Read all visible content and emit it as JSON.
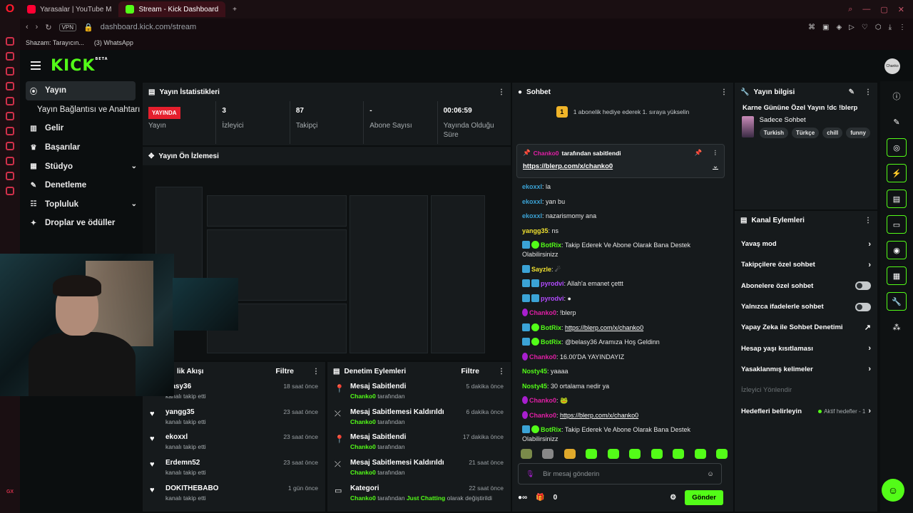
{
  "browser": {
    "tabs": [
      {
        "label": "Yarasalar | YouTube M",
        "active": false
      },
      {
        "label": "Stream - Kick Dashboard",
        "active": true
      }
    ],
    "new_tab": "+",
    "vpn": "VPN",
    "url": "dashboard.kick.com/stream",
    "bookmarks": [
      "Shazam: Tarayıcın...",
      "(3) WhatsApp"
    ],
    "gx": "GX"
  },
  "app": {
    "logo": "KICK",
    "logo_badge": "BETA",
    "avatar_text": "Chanko"
  },
  "nav": {
    "items": [
      {
        "label": "Yayın",
        "icon": "((•))"
      },
      {
        "label": "Yayın Bağlantısı ve Anahtarı",
        "icon": ""
      },
      {
        "label": "Gelir",
        "icon": "▣"
      },
      {
        "label": "Başarılar",
        "icon": "🏆"
      },
      {
        "label": "Stüdyo",
        "icon": "▦",
        "chevron": "⌄"
      },
      {
        "label": "Denetleme",
        "icon": "🔧"
      },
      {
        "label": "Topluluk",
        "icon": "👥",
        "chevron": "⌄"
      },
      {
        "label": "Droplar ve ödüller",
        "icon": "🎁"
      }
    ]
  },
  "stats": {
    "title": "Yayın İstatistikleri",
    "badge": "YAYINDA",
    "cells": [
      {
        "value": "",
        "label": "Yayın"
      },
      {
        "value": "3",
        "label": "İzleyici"
      },
      {
        "value": "87",
        "label": "Takipçi"
      },
      {
        "value": "-",
        "label": "Abone Sayısı"
      },
      {
        "value": "00:06:59",
        "label": "Yayında Olduğu Süre"
      }
    ]
  },
  "preview": {
    "title": "Yayın Ön İzlemesi"
  },
  "activity": {
    "title": "Etkinlik Akışı",
    "title_visible": "lik Akışı",
    "filter": "Filtre",
    "items": [
      {
        "name": "belasy36",
        "visible": "elasy36",
        "sub": "kanalı takip etti",
        "time": "18 saat önce"
      },
      {
        "name": "yangg35",
        "sub": "kanalı takip etti",
        "time": "23 saat önce"
      },
      {
        "name": "ekoxxl",
        "sub": "kanalı takip etti",
        "time": "23 saat önce"
      },
      {
        "name": "Erdemn52",
        "sub": "kanalı takip etti",
        "time": "23 saat önce"
      },
      {
        "name": "DOKITHEBABO",
        "sub": "kanalı takip etti",
        "time": "1 gün önce"
      }
    ]
  },
  "mod_actions": {
    "title": "Denetim Eylemleri",
    "filter": "Filtre",
    "items": [
      {
        "title": "Mesaj Sabitlendi",
        "icon": "📌",
        "actor": "Chanko0",
        "rest": "tarafından",
        "time": "5 dakika önce"
      },
      {
        "title": "Mesaj Sabitlemesi Kaldırıldı",
        "icon": "⤫",
        "actor": "Chanko0",
        "rest": "tarafından",
        "time": "6 dakika önce"
      },
      {
        "title": "Mesaj Sabitlendi",
        "icon": "📌",
        "actor": "Chanko0",
        "rest": "tarafından",
        "time": "17 dakika önce"
      },
      {
        "title": "Mesaj Sabitlemesi Kaldırıldı",
        "icon": "⤫",
        "actor": "Chanko0",
        "rest": "tarafından",
        "time": "21 saat önce"
      },
      {
        "title": "Kategori",
        "icon": "▭",
        "actor": "Chanko0",
        "rest": "tarafından",
        "cat": "Just Chatting",
        "tail": "olarak değiştirildi",
        "time": "22 saat önce"
      }
    ]
  },
  "chat": {
    "title": "Sohbet",
    "sub_rank": "1",
    "sub_banner": "1 abonelik hediye ederek 1. sıraya yükselin",
    "pinned_by": "Chanko0",
    "pinned_label": "tarafından sabitlendi",
    "pinned_link": "https://blerp.com/x/chanko0",
    "messages": [
      {
        "user": "ekoxxl",
        "color": "#3ba3d6",
        "text": "la",
        "badges": []
      },
      {
        "user": "ekoxxl",
        "color": "#3ba3d6",
        "text": "yan bu",
        "badges": []
      },
      {
        "user": "ekoxxl",
        "color": "#3ba3d6",
        "text": "nazarismomy ana",
        "badges": []
      },
      {
        "user": "yangg35",
        "color": "#f0e130",
        "text": "ns",
        "badges": []
      },
      {
        "user": "BotRix",
        "color": "#53fc18",
        "text": "Takip Ederek Ve Abone Olarak Bana Destek Olabilirsinizz",
        "badges": [
          "b-blue",
          "b-green"
        ]
      },
      {
        "user": "Sayzle",
        "color": "#f0e130",
        "text": "☄",
        "badges": [
          "b-blue"
        ]
      },
      {
        "user": "pyrodvi",
        "color": "#b34bff",
        "text": "Allah'a emanet çettt",
        "badges": [
          "b-blue",
          "b-blue"
        ]
      },
      {
        "user": "pyrodvi",
        "color": "#b34bff",
        "text": "●",
        "badges": [
          "b-blue",
          "b-blue"
        ]
      },
      {
        "user": "Chanko0",
        "color": "#e01fa5",
        "text": "!blerp",
        "badges": [
          "b-pink"
        ]
      },
      {
        "user": "BotRix",
        "color": "#53fc18",
        "text": "https://blerp.com/x/chanko0",
        "link": true,
        "badges": [
          "b-blue",
          "b-green"
        ]
      },
      {
        "user": "BotRix",
        "color": "#53fc18",
        "text": "@belasy36 Aramıza Hoş Geldinn",
        "badges": [
          "b-blue",
          "b-green"
        ]
      },
      {
        "user": "Chanko0",
        "color": "#e01fa5",
        "text": "16.00'DA YAYINDAYIZ",
        "badges": [
          "b-pink"
        ]
      },
      {
        "user": "Nosty45",
        "color": "#53fc18",
        "text": "yaaaa",
        "badges": []
      },
      {
        "user": "Nosty45",
        "color": "#53fc18",
        "text": "30 ortalama nedir ya",
        "badges": []
      },
      {
        "user": "Chanko0",
        "color": "#e01fa5",
        "text": "🐸",
        "badges": [
          "b-pink"
        ]
      },
      {
        "user": "Chanko0",
        "color": "#e01fa5",
        "text": "https://blerp.com/x/chanko0",
        "link": true,
        "badges": [
          "b-pink"
        ]
      },
      {
        "user": "BotRix",
        "color": "#53fc18",
        "text": "Takip Ederek Ve Abone Olarak Bana Destek Olabilirsinizz",
        "badges": [
          "b-blue",
          "b-green"
        ]
      }
    ],
    "emotes": 10,
    "input_placeholder": "Bir mesaj gönderin",
    "count": "0",
    "send": "Gönder"
  },
  "stream_info": {
    "title": "Yayın bilgisi",
    "stream_title": "Karne Gününe Özel Yayın !dc !blerp",
    "category": "Sadece Sohbet",
    "tags": [
      "Turkish",
      "Türkçe",
      "chill",
      "funny"
    ]
  },
  "channel_actions": {
    "title": "Kanal Eylemleri",
    "rows": [
      {
        "label": "Yavaş mod",
        "type": "chevron"
      },
      {
        "label": "Takipçilere özel sohbet",
        "type": "chevron"
      },
      {
        "label": "Abonelere özel sohbet",
        "type": "toggle"
      },
      {
        "label": "Yalnızca ifadelerle sohbet",
        "type": "toggle"
      },
      {
        "label": "Yapay Zeka ile Sohbet Denetimi",
        "type": "external"
      },
      {
        "label": "Hesap yaşı kısıtlaması",
        "type": "chevron"
      },
      {
        "label": "Yasaklanmış kelimeler",
        "type": "chevron"
      },
      {
        "label": "İzleyici Yönlendir",
        "type": "disabled"
      },
      {
        "label": "Hedefleri belirleyin",
        "type": "goal",
        "sub": "Aktif hedefler - 1"
      }
    ]
  },
  "colors": {
    "brand": "#53fc18",
    "live": "#e51f2d",
    "panel": "#161a1c",
    "bg": "#0b0e0f"
  }
}
